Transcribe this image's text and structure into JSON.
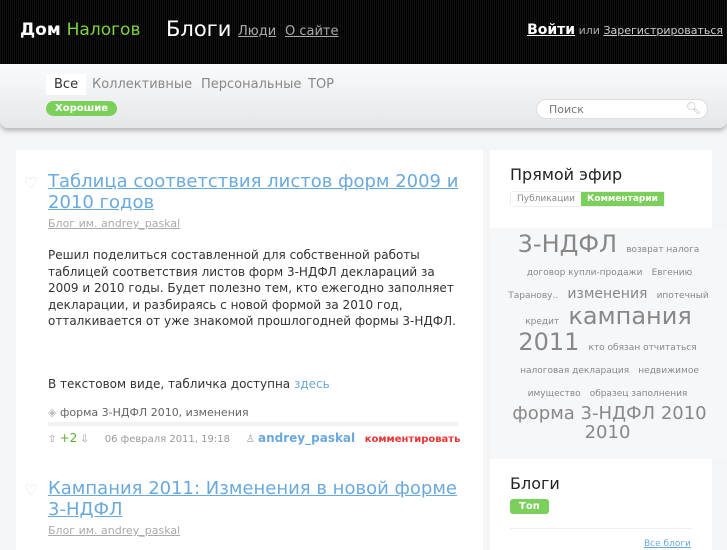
{
  "header": {
    "logo_a": "Дом",
    "logo_b": "Налогов",
    "blogs": "Блоги",
    "people": "Люди",
    "about": "О сайте",
    "login": "Войти",
    "or": "или",
    "register": "Зарегистрироваться"
  },
  "subnav": {
    "tabs": [
      "Все",
      "Коллективные",
      "Персональные",
      "TOP"
    ],
    "filter": "Хорошие",
    "search_placeholder": "Поиск"
  },
  "posts": [
    {
      "title": "Таблица соответствия листов форм 2009 и 2010 годов",
      "blog": "Блог им. andrey_paskal",
      "text": "Решил поделиться составленной для собственной работы таблицей соответствия листов форм 3-НДФЛ деклараций за 2009 и 2010 годы. Будет полезно тем, кто ежегодно заполняет декларации, и разбираясь с новой формой за 2010 год, отталкивается от уже знакомой прошлогодней формы 3-НДФЛ.",
      "text2": "В текстовом виде, табличка доступна",
      "link": "здесь",
      "tags": "форма 3-НДФЛ 2010, изменения",
      "votes": "+2",
      "date": "06 февраля 2011, 19:18",
      "author": "andrey_paskal",
      "comment": "комментировать"
    },
    {
      "title": "Кампания 2011: Изменения в новой форме 3-НДФЛ",
      "blog": "Блог им. andrey_paskal"
    }
  ],
  "sidebar": {
    "live_title": "Прямой эфир",
    "live_tabs": [
      "Публикации",
      "Комментарии"
    ],
    "cloud": [
      {
        "t": "3-НДФЛ",
        "s": 24
      },
      {
        "t": "возврат налога",
        "s": 9
      },
      {
        "t": "договор купли-продажи",
        "s": 9
      },
      {
        "t": "Евгению Таранову..",
        "s": 9
      },
      {
        "t": "изменения",
        "s": 14
      },
      {
        "t": "ипотечный кредит",
        "s": 9
      },
      {
        "t": "кампания 2011",
        "s": 24
      },
      {
        "t": "кто обязан отчитаться",
        "s": 9
      },
      {
        "t": "налоговая декларация",
        "s": 9
      },
      {
        "t": "недвижимое имущество",
        "s": 9
      },
      {
        "t": "образец заполнения",
        "s": 9
      },
      {
        "t": "форма 3-НДФЛ 2010 2010",
        "s": 18
      }
    ],
    "blogs_title": "Блоги",
    "blogs_tab": "Топ",
    "all_blogs": "Все блоги"
  }
}
